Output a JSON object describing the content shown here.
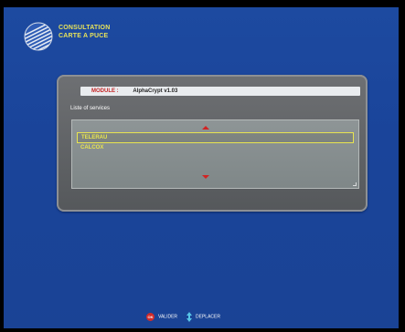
{
  "header": {
    "title_line1": "CONSULTATION",
    "title_line2": "CARTE A PUCE",
    "logo_icon": "striped-globe-logo"
  },
  "module": {
    "label": "MODULE :",
    "value": "AlphaCrypt v1.03"
  },
  "services": {
    "label": "Liste of services",
    "items": [
      {
        "label": "TELERAU",
        "selected": true
      },
      {
        "label": "CALCOX",
        "selected": false
      }
    ]
  },
  "footer": {
    "ok_badge": "OK",
    "validate_label": "VALIDER",
    "move_label": "DEPLACER",
    "ok_icon": "ok-button-icon",
    "nav_icon": "up-down-arrows-icon"
  },
  "colors": {
    "background": "#1b459b",
    "accent_yellow": "#e8e450",
    "accent_red": "#d22323",
    "panel_gray": "#606366"
  }
}
